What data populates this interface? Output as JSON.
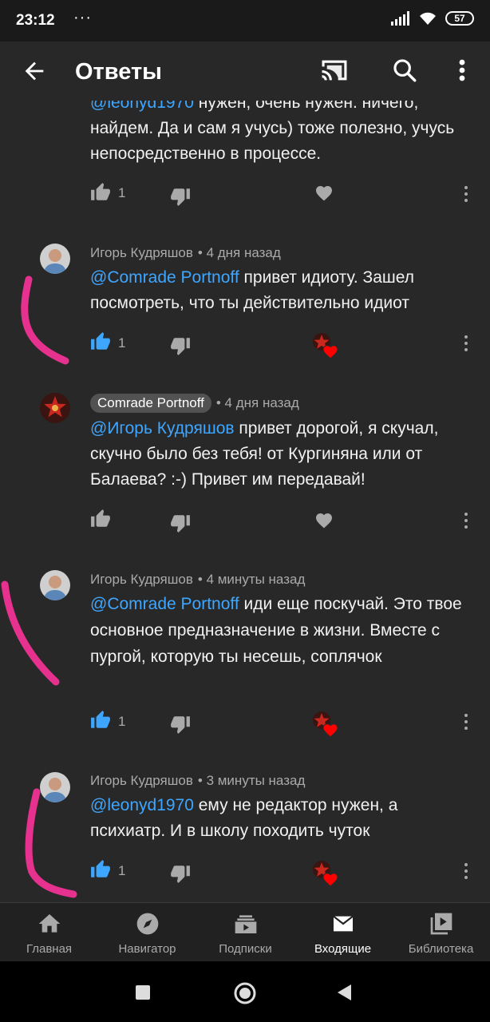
{
  "status_bar": {
    "time": "23:12",
    "dots": "···",
    "battery": "57"
  },
  "app_bar": {
    "title": "Ответы"
  },
  "comments": [
    {
      "text_parts": [
        "@leonyd1970",
        " нужен, очень нужен. ничего, найдем. Да и сам я учусь) тоже полезно, учусь непосредственно в процессе."
      ],
      "likes": "1"
    },
    {
      "author": "Игорь Кудряшов",
      "time": "• 4 дня назад",
      "mention": "@Comrade Portnoff",
      "text": " привет идиоту. Зашел посмотреть, что ты действительно идиот",
      "likes": "1"
    },
    {
      "author": "Comrade Portnoff",
      "time": "• 4 дня назад",
      "mention": "@Игорь Кудряшов",
      "text": " привет дорогой, я скучал, скучно было без тебя! от Кургиняна или от Балаева? :-) Привет им передавай!"
    },
    {
      "author": "Игорь Кудряшов",
      "time": "• 4 минуты назад",
      "mention": "@Comrade Portnoff",
      "text": " иди еще поскучай. Это твое основное предназначение в жизни. Вместе с пургой, которую ты несешь, соплячок",
      "likes": "1"
    },
    {
      "author": "Игорь Кудряшов",
      "time": "• 3 минуты назад",
      "mention": "@leonyd1970",
      "text": " ему не редактор нужен, а психиатр. И в школу походить чуток",
      "likes": "1"
    }
  ],
  "bottom_nav": [
    {
      "label": "Главная",
      "icon": "home-icon"
    },
    {
      "label": "Навигатор",
      "icon": "compass-icon"
    },
    {
      "label": "Подписки",
      "icon": "subscriptions-icon"
    },
    {
      "label": "Входящие",
      "icon": "inbox-icon",
      "active": true
    },
    {
      "label": "Библиотека",
      "icon": "library-icon"
    }
  ],
  "colors": {
    "background": "#282828",
    "mention": "#3ea6ff",
    "like_active": "#3ea6ff",
    "heart": "#ff0000",
    "scribble": "#e6318f"
  }
}
